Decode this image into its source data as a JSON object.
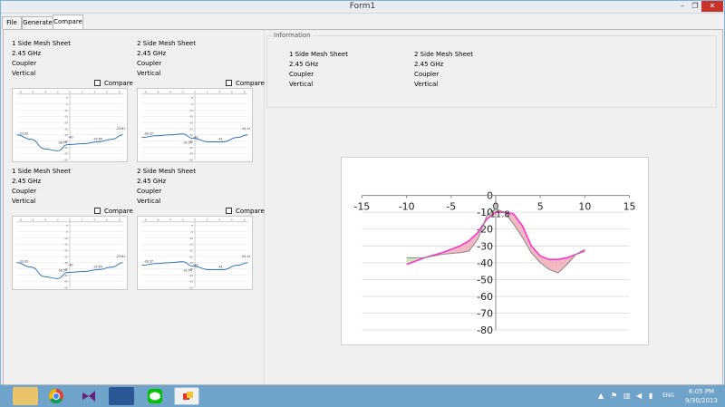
{
  "window": {
    "title": "Form1",
    "min": "–",
    "max": "❐",
    "close": "✕"
  },
  "tabs": [
    "File",
    "Generate",
    "Compare"
  ],
  "panels": [
    {
      "title": "1 Side Mesh Sheet",
      "freq": "2.45 GHz",
      "type": "Coupler",
      "orient": "Vertical",
      "compare_label": "Compare",
      "labels": [
        "-33.03",
        "-38.54",
        "-40",
        "-33.65",
        "-23.61"
      ]
    },
    {
      "title": "2 Side Mesh Sheet",
      "freq": "2.45 GHz",
      "type": "Coupler",
      "orient": "Vertical",
      "compare_label": "Compare",
      "labels": [
        "-30.37",
        "-32.54",
        "-40",
        "-41",
        "-34.14"
      ]
    },
    {
      "title": "1 Side Mesh Sheet",
      "freq": "2.45 GHz",
      "type": "Coupler",
      "orient": "Vertical",
      "compare_label": "Compare",
      "labels": [
        "-33.03",
        "-38.54",
        "-40",
        "-33.65",
        "-23.61"
      ]
    },
    {
      "title": "2 Side Mesh Sheet",
      "freq": "2.45 GHz",
      "type": "Coupler",
      "orient": "Vertical",
      "compare_label": "Compare",
      "labels": [
        "-30.37",
        "-32.54",
        "-40",
        "-41",
        "-34.14"
      ]
    }
  ],
  "mini_axis": {
    "x_ticks": [
      "-8",
      "-6",
      "-4",
      "-2",
      "0",
      "2",
      "4",
      "6",
      "8"
    ],
    "y_ticks": [
      "0",
      "-5",
      "-10",
      "-15",
      "-20",
      "-25",
      "-30",
      "-35",
      "-40",
      "-45",
      "-50"
    ]
  },
  "information": {
    "legend": "Information",
    "col1": [
      "1 Side Mesh Sheet",
      "2.45 GHz",
      "Coupler",
      "Vertical"
    ],
    "col2": [
      "2 Side Mesh Sheet",
      "2.45 GHz",
      "Coupler",
      "Vertical"
    ]
  },
  "chart_data": {
    "type": "area",
    "xlim": [
      -15,
      15
    ],
    "ylim": [
      -80,
      0
    ],
    "x_ticks": [
      "-15",
      "-10",
      "-5",
      "0",
      "5",
      "10",
      "15"
    ],
    "y_ticks": [
      "0",
      "-10",
      "-20",
      "-30",
      "-40",
      "-50",
      "-60",
      "-70",
      "-80"
    ],
    "annotation": "-11.8",
    "series": [
      {
        "color": "#ff33cc",
        "x": [
          -10,
          -8,
          -6,
          -4,
          -3,
          -2,
          -1,
          0,
          1,
          2,
          3,
          4,
          5,
          6,
          7,
          8,
          9,
          10
        ],
        "y": [
          -41,
          -37,
          -34,
          -30,
          -27,
          -22,
          -14,
          -10,
          -10,
          -11,
          -18,
          -30,
          -36,
          -38,
          -38,
          -37,
          -35,
          -33
        ]
      },
      {
        "color": "#888888",
        "x": [
          -10,
          -8,
          -6,
          -4,
          -3,
          -2,
          -1,
          0,
          1,
          2,
          3,
          4,
          5,
          6,
          7,
          8,
          9,
          10
        ],
        "y": [
          -37,
          -37,
          -35,
          -34,
          -33,
          -26,
          -12,
          -8,
          -10,
          -17,
          -25,
          -34,
          -40,
          -44,
          -46,
          -41,
          -35,
          -32
        ]
      }
    ],
    "fill_colors": [
      "#efa8b3",
      "#b9e2a8"
    ]
  },
  "taskbar": {
    "tray_lang": "ENG",
    "time": "6:05 PM",
    "date": "9/30/2013"
  }
}
